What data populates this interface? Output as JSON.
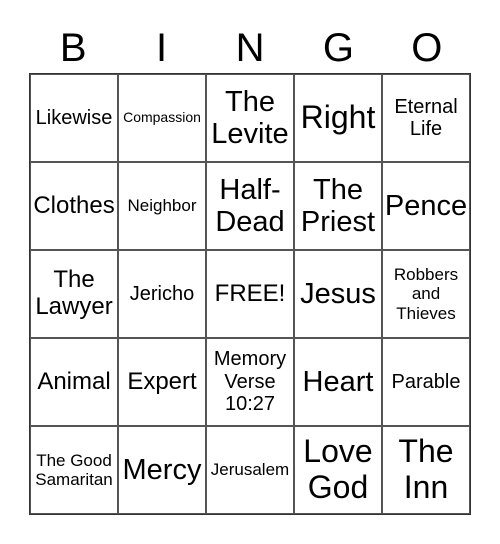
{
  "header": [
    "B",
    "I",
    "N",
    "G",
    "O"
  ],
  "cells": [
    {
      "text": "Likewise",
      "size": "s-md"
    },
    {
      "text": "Compassion",
      "size": "s-xs"
    },
    {
      "text": "The Levite",
      "size": "s-xl"
    },
    {
      "text": "Right",
      "size": "s-xxl"
    },
    {
      "text": "Eternal Life",
      "size": "s-md"
    },
    {
      "text": "Clothes",
      "size": "s-lg"
    },
    {
      "text": "Neighbor",
      "size": "s-sm"
    },
    {
      "text": "Half-Dead",
      "size": "s-xl"
    },
    {
      "text": "The Priest",
      "size": "s-xl"
    },
    {
      "text": "Pence",
      "size": "s-xl"
    },
    {
      "text": "The Lawyer",
      "size": "s-lg"
    },
    {
      "text": "Jericho",
      "size": "s-md"
    },
    {
      "text": "FREE!",
      "size": "s-lg"
    },
    {
      "text": "Jesus",
      "size": "s-xl"
    },
    {
      "text": "Robbers and Thieves",
      "size": "s-sm"
    },
    {
      "text": "Animal",
      "size": "s-lg"
    },
    {
      "text": "Expert",
      "size": "s-lg"
    },
    {
      "text": "Memory Verse 10:27",
      "size": "s-md"
    },
    {
      "text": "Heart",
      "size": "s-xl"
    },
    {
      "text": "Parable",
      "size": "s-md"
    },
    {
      "text": "The Good Samaritan",
      "size": "s-sm"
    },
    {
      "text": "Mercy",
      "size": "s-xl"
    },
    {
      "text": "Jerusalem",
      "size": "s-sm"
    },
    {
      "text": "Love God",
      "size": "s-xxl"
    },
    {
      "text": "The Inn",
      "size": "s-xxl"
    }
  ]
}
